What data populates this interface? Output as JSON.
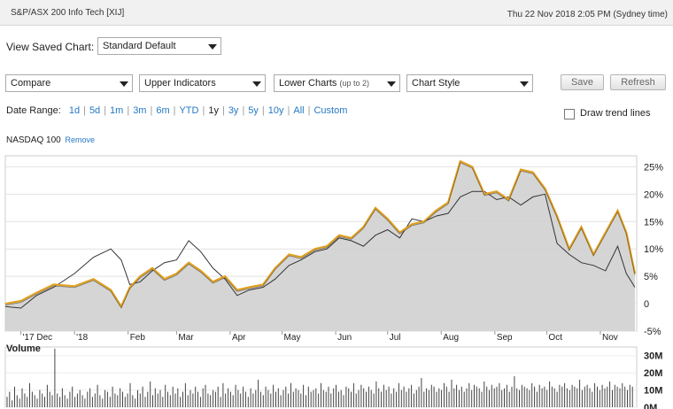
{
  "header": {
    "title": "S&P/ASX 200 Info Tech [XIJ]",
    "timestamp": "Thu 22 Nov 2018 2:05 PM (Sydney time)"
  },
  "saved_chart": {
    "label": "View Saved Chart:",
    "value": "Standard Default"
  },
  "toolbar": {
    "compare": "Compare",
    "upper_indicators": "Upper Indicators",
    "lower_charts": "Lower Charts",
    "lower_charts_note": "(up to 2)",
    "chart_style": "Chart Style",
    "save": "Save",
    "refresh": "Refresh"
  },
  "date_range": {
    "label": "Date Range:",
    "options": [
      "1d",
      "5d",
      "1m",
      "3m",
      "6m",
      "YTD",
      "1y",
      "3y",
      "5y",
      "10y",
      "All",
      "Custom"
    ],
    "selected": "1y"
  },
  "trend_lines": {
    "label": "Draw trend lines",
    "checked": false
  },
  "comparison": {
    "name": "NASDAQ 100",
    "remove": "Remove"
  },
  "colors": {
    "main_line": "#e0a020",
    "compare_line": "#333333",
    "area_fill": "#d0d0d0",
    "volume_bars": "#444444",
    "link": "#2479c4"
  },
  "chart_data": {
    "type": "line",
    "x_tick_labels": [
      "'17 Dec",
      "'18",
      "Feb",
      "Mar",
      "Apr",
      "May",
      "Jun",
      "Jul",
      "Aug",
      "Sep",
      "Oct",
      "Nov"
    ],
    "y_tick_labels": [
      "25%",
      "20%",
      "15%",
      "10%",
      "5%",
      "0",
      "-5%"
    ],
    "ylim": [
      -5,
      27
    ],
    "series": [
      {
        "name": "S&P/ASX 200 Info Tech [XIJ]",
        "style": "area",
        "x": [
          "2017-11-22",
          "2017-12-01",
          "2017-12-10",
          "2017-12-20",
          "2018-01-01",
          "2018-01-12",
          "2018-01-22",
          "2018-01-28",
          "2018-02-02",
          "2018-02-08",
          "2018-02-15",
          "2018-02-22",
          "2018-03-01",
          "2018-03-08",
          "2018-03-15",
          "2018-03-22",
          "2018-03-29",
          "2018-04-05",
          "2018-04-12",
          "2018-04-20",
          "2018-04-27",
          "2018-05-05",
          "2018-05-12",
          "2018-05-20",
          "2018-05-27",
          "2018-06-03",
          "2018-06-10",
          "2018-06-17",
          "2018-06-24",
          "2018-07-01",
          "2018-07-08",
          "2018-07-15",
          "2018-07-22",
          "2018-07-29",
          "2018-08-05",
          "2018-08-12",
          "2018-08-19",
          "2018-08-26",
          "2018-09-02",
          "2018-09-09",
          "2018-09-16",
          "2018-09-23",
          "2018-09-30",
          "2018-10-07",
          "2018-10-14",
          "2018-10-21",
          "2018-10-28",
          "2018-11-04",
          "2018-11-11",
          "2018-11-16",
          "2018-11-21"
        ],
        "y": [
          0.0,
          0.5,
          2.0,
          3.5,
          3.2,
          4.5,
          2.5,
          -0.5,
          3.0,
          5.0,
          6.5,
          4.5,
          5.5,
          7.5,
          6.0,
          4.0,
          5.0,
          2.5,
          3.0,
          3.5,
          6.5,
          9.0,
          8.5,
          10.0,
          10.5,
          12.5,
          12.0,
          14.0,
          17.5,
          15.5,
          13.0,
          14.5,
          15.0,
          17.0,
          18.5,
          26.0,
          25.0,
          20.0,
          20.5,
          19.0,
          24.5,
          24.0,
          21.0,
          16.0,
          10.0,
          14.0,
          9.0,
          13.0,
          17.0,
          13.0,
          5.5
        ]
      },
      {
        "name": "NASDAQ 100",
        "style": "line",
        "x": [
          "2017-11-22",
          "2017-12-01",
          "2017-12-10",
          "2017-12-20",
          "2018-01-01",
          "2018-01-12",
          "2018-01-22",
          "2018-01-28",
          "2018-02-02",
          "2018-02-08",
          "2018-02-15",
          "2018-02-22",
          "2018-03-01",
          "2018-03-08",
          "2018-03-15",
          "2018-03-22",
          "2018-03-29",
          "2018-04-05",
          "2018-04-12",
          "2018-04-20",
          "2018-04-27",
          "2018-05-05",
          "2018-05-12",
          "2018-05-20",
          "2018-05-27",
          "2018-06-03",
          "2018-06-10",
          "2018-06-17",
          "2018-06-24",
          "2018-07-01",
          "2018-07-08",
          "2018-07-15",
          "2018-07-22",
          "2018-07-29",
          "2018-08-05",
          "2018-08-12",
          "2018-08-19",
          "2018-08-26",
          "2018-09-02",
          "2018-09-09",
          "2018-09-16",
          "2018-09-23",
          "2018-09-30",
          "2018-10-07",
          "2018-10-14",
          "2018-10-21",
          "2018-10-28",
          "2018-11-04",
          "2018-11-11",
          "2018-11-16",
          "2018-11-21"
        ],
        "y": [
          -0.5,
          -0.8,
          1.5,
          3.0,
          5.5,
          8.5,
          10.0,
          8.0,
          3.5,
          4.0,
          6.0,
          7.5,
          8.0,
          11.5,
          9.5,
          6.5,
          4.5,
          1.5,
          2.5,
          3.0,
          4.5,
          7.0,
          8.0,
          9.5,
          10.0,
          12.0,
          11.5,
          10.5,
          12.5,
          13.5,
          12.0,
          15.5,
          15.0,
          16.0,
          16.5,
          19.5,
          20.5,
          20.5,
          19.0,
          19.5,
          18.0,
          19.5,
          20.0,
          11.0,
          9.0,
          7.5,
          7.0,
          6.0,
          10.5,
          5.5,
          3.0
        ]
      }
    ],
    "volume": {
      "label": "Volume",
      "y_tick_labels": [
        "30M",
        "20M",
        "10M",
        "0M"
      ],
      "ylim": [
        0,
        35
      ],
      "values": [
        6,
        9,
        4,
        12,
        7,
        5,
        11,
        8,
        6,
        14,
        9,
        7,
        5,
        10,
        8,
        6,
        13,
        9,
        7,
        34,
        8,
        6,
        11,
        7,
        5,
        9,
        12,
        6,
        8,
        10,
        7,
        5,
        9,
        11,
        6,
        8,
        13,
        7,
        5,
        10,
        9,
        6,
        12,
        8,
        7,
        11,
        9,
        6,
        8,
        14,
        7,
        5,
        10,
        8,
        12,
        6,
        9,
        15,
        7,
        11,
        8,
        10,
        6,
        13,
        9,
        7,
        12,
        8,
        11,
        6,
        9,
        14,
        7,
        10,
        8,
        12,
        9,
        6,
        11,
        13,
        8,
        7,
        10,
        9,
        12,
        6,
        14,
        8,
        11,
        9,
        7,
        13,
        10,
        8,
        12,
        9,
        6,
        11,
        8,
        10,
        16,
        9,
        7,
        12,
        10,
        8,
        13,
        9,
        11,
        7,
        10,
        12,
        8,
        14,
        9,
        11,
        10,
        8,
        13,
        7,
        12,
        9,
        10,
        11,
        8,
        14,
        10,
        9,
        12,
        8,
        11,
        13,
        9,
        10,
        7,
        12,
        11,
        9,
        14,
        8,
        10,
        13,
        11,
        9,
        12,
        10,
        8,
        15,
        11,
        9,
        13,
        10,
        12,
        8,
        11,
        9,
        14,
        10,
        12,
        9,
        11,
        13,
        8,
        10,
        12,
        17,
        9,
        11,
        10,
        13,
        12,
        9,
        11,
        10,
        14,
        12,
        9,
        16,
        11,
        13,
        10,
        12,
        9,
        11,
        14,
        10,
        13,
        12,
        11,
        9,
        15,
        12,
        10,
        13,
        11,
        12,
        14,
        10,
        11,
        13,
        9,
        12,
        18,
        11,
        10,
        13,
        12,
        11,
        10,
        14,
        12,
        9,
        13,
        11,
        12,
        10,
        15,
        12,
        11,
        9,
        13,
        12,
        14,
        11,
        10,
        13,
        12,
        11,
        16,
        10,
        12,
        13,
        11,
        9,
        14,
        12,
        10,
        13,
        11,
        12,
        15,
        10,
        13,
        12,
        11,
        14,
        12,
        10,
        13,
        12
      ]
    }
  }
}
